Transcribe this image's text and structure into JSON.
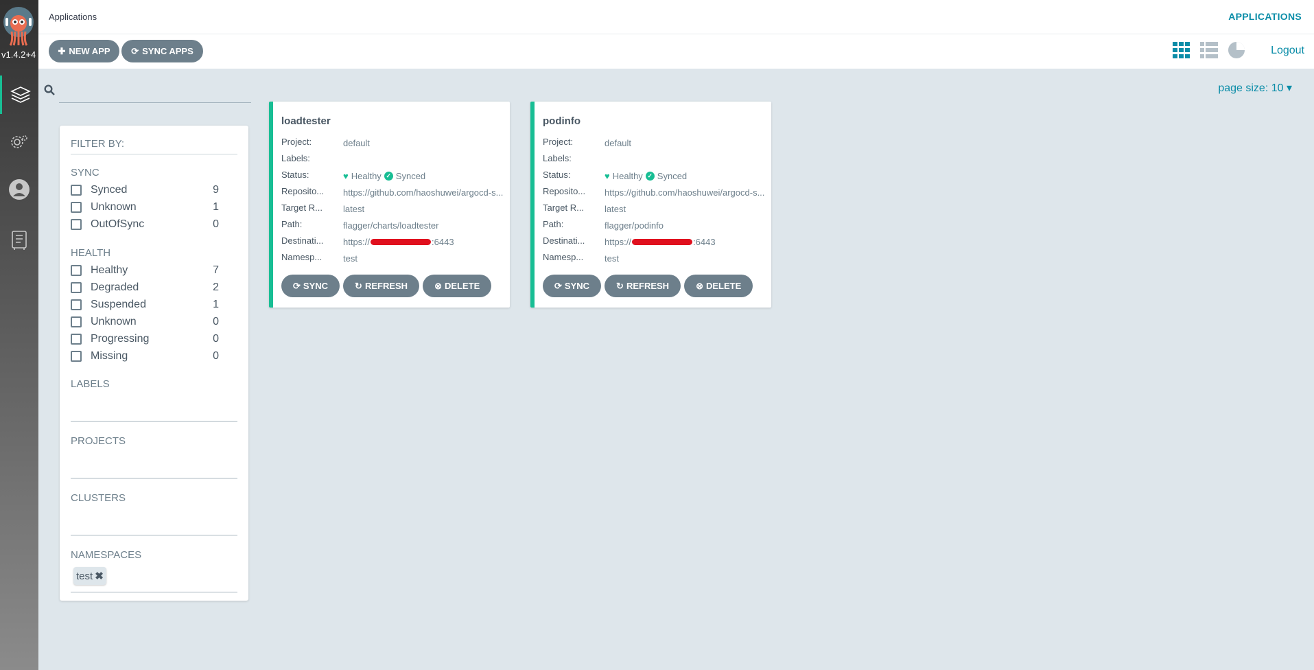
{
  "sidebar": {
    "version": "v1.4.2+4",
    "items": [
      {
        "name": "applications",
        "icon": "layers-icon",
        "active": true
      },
      {
        "name": "settings",
        "icon": "gear-icon"
      },
      {
        "name": "user-info",
        "icon": "user-icon"
      },
      {
        "name": "docs",
        "icon": "docs-icon"
      }
    ]
  },
  "header": {
    "title": "Applications",
    "nav_label": "APPLICATIONS"
  },
  "toolbar": {
    "new_app": "NEW APP",
    "sync_apps": "SYNC APPS",
    "logout": "Logout",
    "views": [
      "tiles-view-icon",
      "list-view-icon",
      "summary-view-icon"
    ],
    "active_view": "tiles"
  },
  "search": {
    "placeholder": "",
    "value": ""
  },
  "pagination": {
    "page_size": "page size: 10"
  },
  "filter": {
    "title": "FILTER BY:",
    "sync": {
      "title": "SYNC",
      "items": [
        {
          "label": "Synced",
          "count": "9"
        },
        {
          "label": "Unknown",
          "count": "1"
        },
        {
          "label": "OutOfSync",
          "count": "0"
        }
      ]
    },
    "health": {
      "title": "HEALTH",
      "items": [
        {
          "label": "Healthy",
          "count": "7"
        },
        {
          "label": "Degraded",
          "count": "2"
        },
        {
          "label": "Suspended",
          "count": "1"
        },
        {
          "label": "Unknown",
          "count": "0"
        },
        {
          "label": "Progressing",
          "count": "0"
        },
        {
          "label": "Missing",
          "count": "0"
        }
      ]
    },
    "labels_title": "LABELS",
    "projects_title": "PROJECTS",
    "clusters_title": "CLUSTERS",
    "namespaces_title": "NAMESPACES",
    "namespace_tags": [
      "test"
    ]
  },
  "field_labels": {
    "project": "Project:",
    "labels": "Labels:",
    "status": "Status:",
    "repository": "Reposito...",
    "target": "Target R...",
    "path": "Path:",
    "destination": "Destinati...",
    "namespace": "Namesp..."
  },
  "card_buttons": {
    "sync": "SYNC",
    "refresh": "REFRESH",
    "delete": "DELETE"
  },
  "apps": [
    {
      "name": "loadtester",
      "project": "default",
      "labels": "",
      "health": "Healthy",
      "sync": "Synced",
      "repository": "https://github.com/haoshuwei/argocd-s...",
      "target": "latest",
      "path": "flagger/charts/loadtester",
      "destination_prefix": "https://",
      "destination_suffix": ":6443",
      "namespace": "test"
    },
    {
      "name": "podinfo",
      "project": "default",
      "labels": "",
      "health": "Healthy",
      "sync": "Synced",
      "repository": "https://github.com/haoshuwei/argocd-s...",
      "target": "latest",
      "path": "flagger/podinfo",
      "destination_prefix": "https://",
      "destination_suffix": ":6443",
      "namespace": "test"
    }
  ],
  "colors": {
    "accent": "#0b8da8",
    "healthy": "#18be94",
    "button": "#6d7f8b",
    "background": "#dee6eb"
  }
}
